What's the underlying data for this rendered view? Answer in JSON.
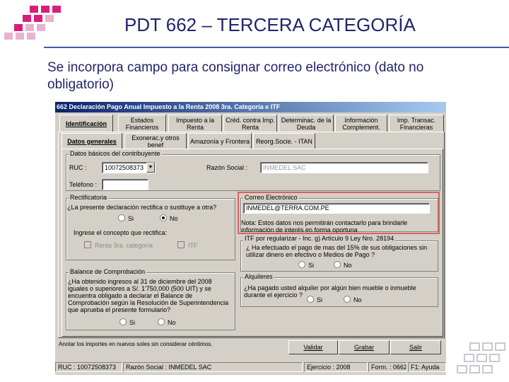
{
  "slide": {
    "title": "PDT 662 – TERCERA CATEGORÍA",
    "subtitle": "Se incorpora campo para consignar correo electrónico (dato no obligatorio)"
  },
  "window": {
    "title": "662 Declaración Pago Anual Impuesto a la Renta 2008 3ra. Categoría e ITF"
  },
  "main_tabs": [
    {
      "label": "Identificación"
    },
    {
      "label": "Estados Financieros"
    },
    {
      "label": "Impuesto a la Renta"
    },
    {
      "label": "Créd. contra Imp. Renta"
    },
    {
      "label": "Determinac. de la Deuda"
    },
    {
      "label": "Información Complement."
    },
    {
      "label": "Imp. Transac. Financieras"
    }
  ],
  "sub_tabs": [
    {
      "label": "Datos generales"
    },
    {
      "label": "Exonerac.y otros benef"
    },
    {
      "label": "Amazonía y Frontera"
    },
    {
      "label": "Reorg.Socie. - ITAN"
    }
  ],
  "datos_basicos": {
    "legend": "Datos básicos del contribuyente",
    "ruc_label": "RUC :",
    "ruc_value": "10072508373",
    "razon_label": "Razón Social :",
    "razon_value": "INMEDEL SAC",
    "telefono_label": "Teléfono :",
    "telefono_value": ""
  },
  "rectificatoria": {
    "legend": "Rectificatoria",
    "question": "¿La presente declaración rectifica o sustituye a otra?",
    "si": "Si",
    "no": "No",
    "concepto_label": "Ingrese el concepto que rectifica:",
    "renta_label": "Renta 3ra. categoría",
    "itf_label": "ITF"
  },
  "correo": {
    "legend": "Correo Electrónico",
    "value": "INMEDEL@TERRA.COM.PE",
    "note": "Nota: Estos datos nos permitirán contactarlo para brindarle información de interés en forma oportuna"
  },
  "itf": {
    "legend": "ITF por regularizar - Inc. g) Artículo 9 Ley Nro. 28194",
    "question": "¿ Ha efectuado el pago de mas del 15% de sus obligaciones sin utilizar dinero en efectivo o Medios de Pago ?",
    "si": "Si",
    "no": "No"
  },
  "balance": {
    "legend": "Balance de Comprobación",
    "question": "¿Ha obtenido ingresos al 31 de diciembre del 2008 iguales o superiores a S/. 1'750,000 (500 UIT) y se encuentra obligado a declarar el Balance de Comprobación según la Resolución de Superintendencia que aprueba el presente formulario?",
    "si": "Si",
    "no": "No"
  },
  "alquileres": {
    "legend": "Alquileres",
    "question": "¿Ha pagado usted alquiler por algún bien mueble o inmueble durante el ejercicio ?",
    "si": "Si",
    "no": "No"
  },
  "footer": {
    "hint": "Anotar los importes en nuevos soles sin considerar céntimos.",
    "validar": "Validar",
    "grabar": "Grabar",
    "salir": "Salir"
  },
  "status_bar": {
    "ruc": "RUC : 10072508373",
    "razon": "Razón Social : INMEDEL SAC",
    "ejercicio": "Ejercicio : 2008",
    "form": "Form. : 0662",
    "ayuda": "F1: Ayuda"
  },
  "colors": {
    "title_blue": "#22236b",
    "accent_magenta": "#d81e7c",
    "highlight_red": "#e06060",
    "window_gray": "#d4d0c8"
  }
}
